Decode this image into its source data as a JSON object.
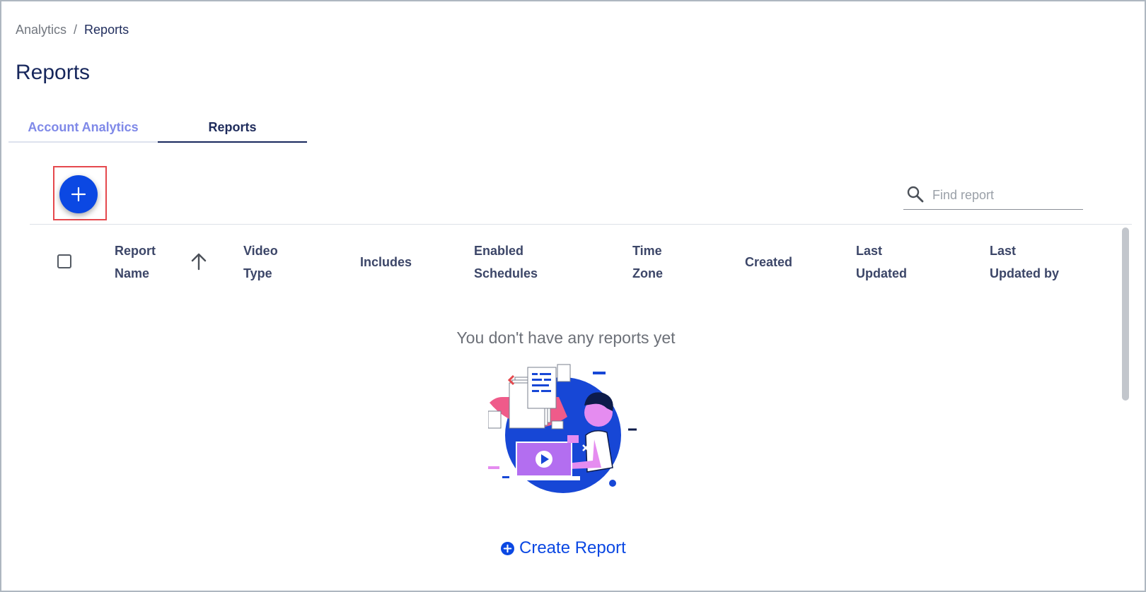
{
  "breadcrumb": {
    "parent": "Analytics",
    "separator": "/",
    "current": "Reports"
  },
  "page": {
    "title": "Reports"
  },
  "tabs": [
    {
      "label": "Account Analytics",
      "active": false
    },
    {
      "label": "Reports",
      "active": true
    }
  ],
  "toolbar": {
    "add_icon": "plus-icon",
    "search_icon": "search-icon",
    "search_placeholder": "Find report",
    "search_value": ""
  },
  "table": {
    "columns": [
      {
        "line1": "Report",
        "line2": "Name"
      },
      {
        "line1": "Video",
        "line2": "Type"
      },
      {
        "line1": "Includes",
        "line2": ""
      },
      {
        "line1": "Enabled",
        "line2": "Schedules"
      },
      {
        "line1": "Time",
        "line2": "Zone"
      },
      {
        "line1": "Created",
        "line2": ""
      },
      {
        "line1": "Last",
        "line2": "Updated"
      },
      {
        "line1": "Last",
        "line2": "Updated by"
      }
    ],
    "sort_icon": "arrow-up-icon",
    "rows": []
  },
  "empty_state": {
    "message": "You don't have any reports yet",
    "create_label": "Create Report",
    "create_icon": "plus-circle-icon"
  },
  "colors": {
    "accent": "#0b48e3",
    "navy": "#17275c",
    "tab_inactive": "#7f89e8",
    "highlight": "#e5484d"
  }
}
